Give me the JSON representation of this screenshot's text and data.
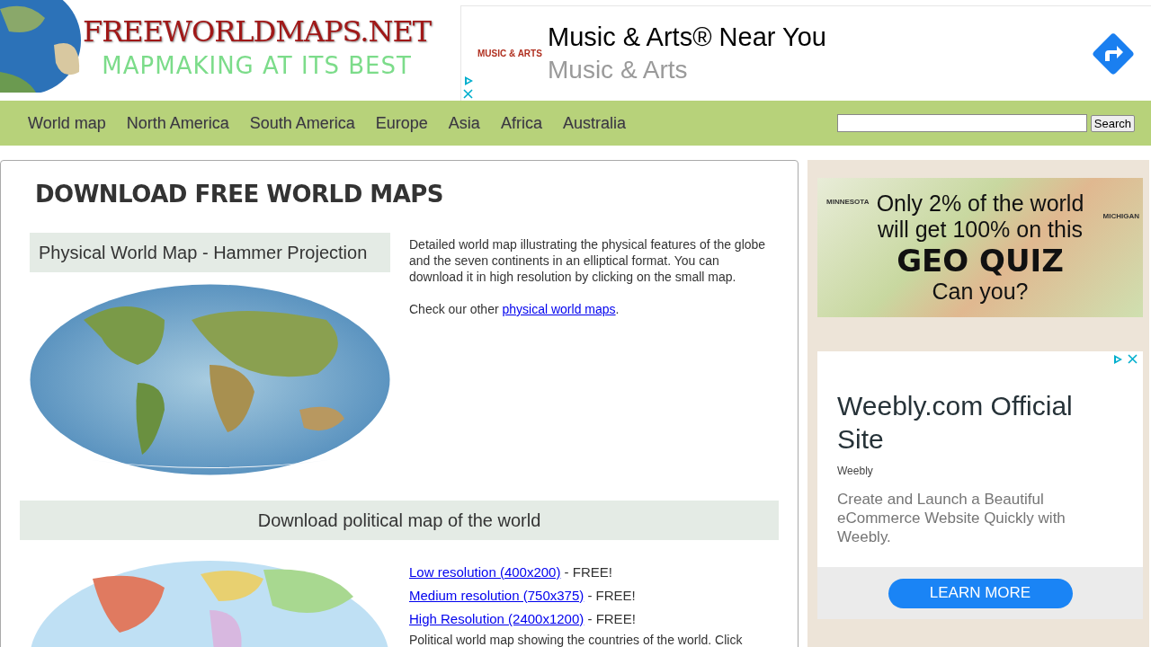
{
  "logo": {
    "title": "FREEWORLDMAPS.NET",
    "tagline": "MAPMAKING AT ITS BEST"
  },
  "top_ad": {
    "brand": "MUSIC & ARTS",
    "headline": "Music & Arts® Near You",
    "advertiser": "Music & Arts"
  },
  "nav": {
    "items": [
      "World map",
      "North America",
      "South America",
      "Europe",
      "Asia",
      "Africa",
      "Australia"
    ],
    "search": {
      "button": "Search"
    }
  },
  "main": {
    "heading": "DOWNLOAD FREE WORLD MAPS",
    "physical": {
      "title": "Physical World Map - Hammer Projection",
      "description": "Detailed world map illustrating the physical features of the globe and the seven continents in an elliptical format. You can download it in high resolution by clicking on the small map.",
      "note": {
        "before": "Check our other ",
        "link": "physical world maps",
        "after": "."
      }
    },
    "political": {
      "title": "Download political map of the world",
      "downloads": [
        {
          "link": "Low resolution (400x200)",
          "suffix": " - FREE!"
        },
        {
          "link": "Medium resolution (750x375)",
          "suffix": " - FREE!"
        },
        {
          "link": "High Resolution (2400x1200)",
          "suffix": " - FREE!"
        }
      ],
      "description": "Political world map showing the countries of the world. Click"
    }
  },
  "sidebar": {
    "quiz_ad": {
      "lines": [
        "Only 2% of the world",
        "will get 100% on this",
        "GEO QUIZ",
        "Can you?"
      ],
      "labels": [
        "MINNESOTA",
        "MICHIGAN"
      ]
    },
    "weebly_ad": {
      "headline": "Weebly.com Official Site",
      "advertiser": "Weebly",
      "body": "Create and Launch a Beautiful eCommerce Website Quickly with Weebly.",
      "button": "LEARN MORE"
    }
  }
}
